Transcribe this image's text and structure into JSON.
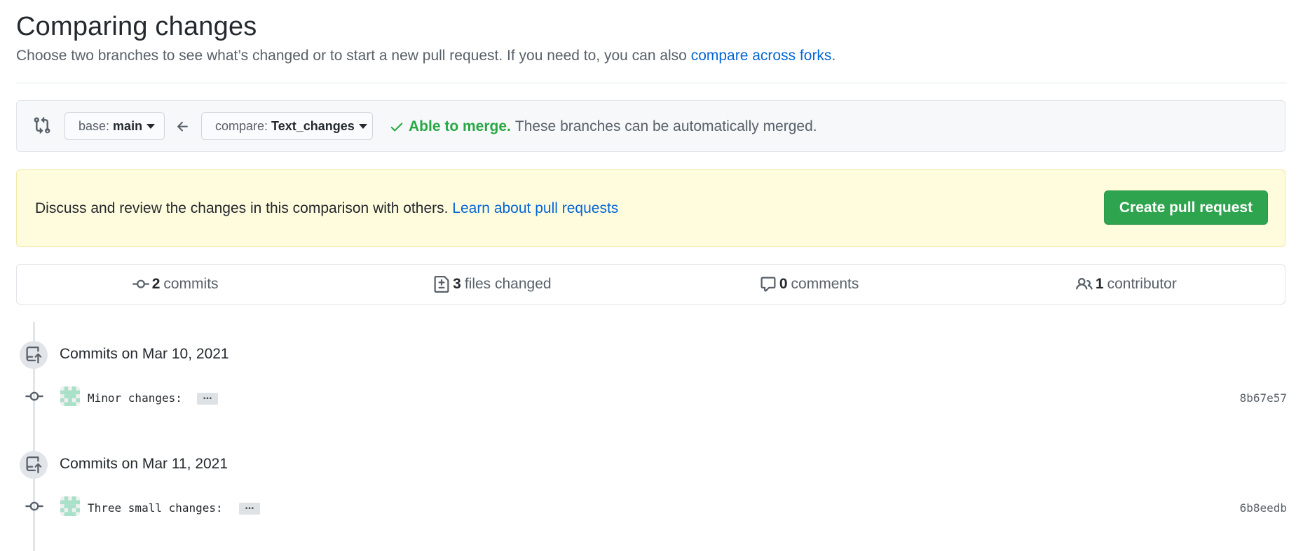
{
  "header": {
    "title": "Comparing changes",
    "subtitle": "Choose two branches to see what’s changed or to start a new pull request. If you need to, you can also ",
    "forks_link": "compare across forks",
    "subtitle_end": "."
  },
  "range": {
    "base_label": "base:",
    "base_branch": "main",
    "compare_label": "compare:",
    "compare_branch": "Text_changes",
    "merge_ok": "Able to merge.",
    "merge_text": "These branches can be automatically merged."
  },
  "flash": {
    "text": "Discuss and review the changes in this comparison with others. ",
    "link": "Learn about pull requests",
    "button": "Create pull request"
  },
  "summary": {
    "commits_num": "2",
    "commits_label": "commits",
    "files_num": "3",
    "files_label": "files changed",
    "comments_num": "0",
    "comments_label": "comments",
    "contributors_num": "1",
    "contributors_label": "contributor"
  },
  "timeline": [
    {
      "date": "Commits on Mar 10, 2021",
      "message": "Minor changes:",
      "ellipsis": "…",
      "sha": "8b67e57"
    },
    {
      "date": "Commits on Mar 11, 2021",
      "message": "Three small changes:",
      "ellipsis": "…",
      "sha": "6b8eedb"
    }
  ],
  "colors": {
    "link": "#0366d6",
    "success": "#28a745",
    "button_green": "#2ea44f",
    "flash_bg": "#fffbdd"
  },
  "icons": {
    "compare": "git-compare-icon",
    "arrow": "arrow-left-icon",
    "check": "check-icon",
    "commit": "git-commit-icon",
    "file_diff": "file-diff-icon",
    "comment": "comment-icon",
    "people": "people-icon",
    "repo_push": "repo-push-icon"
  }
}
